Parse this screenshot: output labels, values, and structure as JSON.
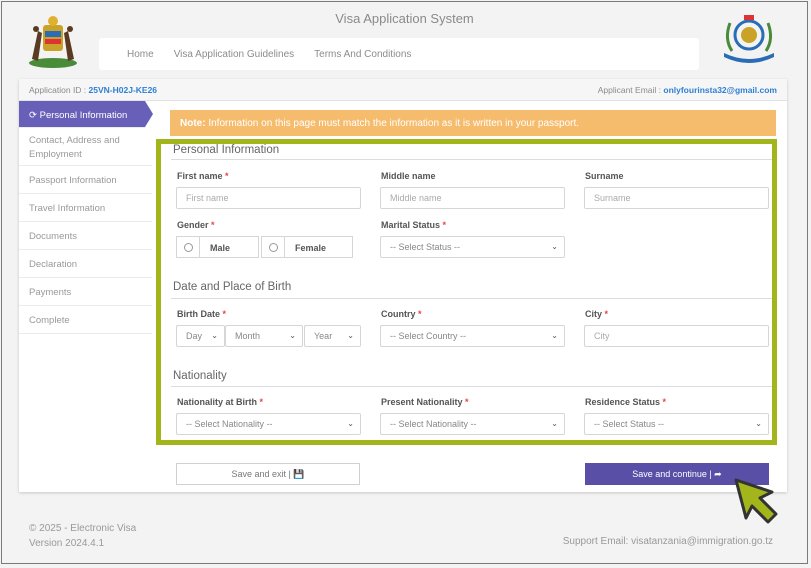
{
  "header": {
    "app_title": "Visa Application System",
    "nav": [
      "Home",
      "Visa Application Guidelines",
      "Terms And Conditions"
    ]
  },
  "application": {
    "id_label": "Application ID : ",
    "id_value": "25VN-H02J-KE26",
    "email_label": "Applicant Email : ",
    "email_value": "onlyfourinsta32@gmail.com"
  },
  "sidebar": {
    "items": [
      {
        "label": "Personal Information",
        "active": true
      },
      {
        "label": "Contact, Address and Employment"
      },
      {
        "label": "Passport Information"
      },
      {
        "label": "Travel Information"
      },
      {
        "label": "Documents"
      },
      {
        "label": "Declaration"
      },
      {
        "label": "Payments"
      },
      {
        "label": "Complete"
      }
    ]
  },
  "note": {
    "prefix": "Note:",
    "text": " Information on this page must match the information as it is written in your passport."
  },
  "sections": {
    "personal": "Personal Information",
    "birth": "Date and Place of Birth",
    "nationality": "Nationality"
  },
  "form": {
    "first_name": {
      "label": "First name",
      "placeholder": "First name"
    },
    "middle_name": {
      "label": "Middle name",
      "placeholder": "Middle name"
    },
    "surname": {
      "label": "Surname",
      "placeholder": "Surname"
    },
    "gender": {
      "label": "Gender",
      "options": [
        "Male",
        "Female"
      ]
    },
    "marital_status": {
      "label": "Marital Status",
      "value": "-- Select Status --"
    },
    "birth_date": {
      "label": "Birth Date",
      "day": "Day",
      "month": "Month",
      "year": "Year"
    },
    "country": {
      "label": "Country",
      "value": "-- Select Country --"
    },
    "city": {
      "label": "City",
      "placeholder": "City"
    },
    "nationality_at_birth": {
      "label": "Nationality at Birth",
      "value": "-- Select Nationality --"
    },
    "present_nationality": {
      "label": "Present Nationality",
      "value": "-- Select Nationality --"
    },
    "residence_status": {
      "label": "Residence Status",
      "value": "-- Select Status --"
    },
    "required_mark": "*"
  },
  "buttons": {
    "save_exit": "Save and exit | 💾",
    "save_continue": "Save and continue | ➦"
  },
  "footer": {
    "copyright": "© 2025 - Electronic Visa",
    "version": "Version 2024.4.1",
    "support": "Support Email: visatanzania@immigration.go.tz"
  },
  "colors": {
    "accent": "#5a4fa6",
    "note_bg": "#f6bc6d",
    "highlight": "#a2b61b",
    "link": "#2e7fd4"
  }
}
